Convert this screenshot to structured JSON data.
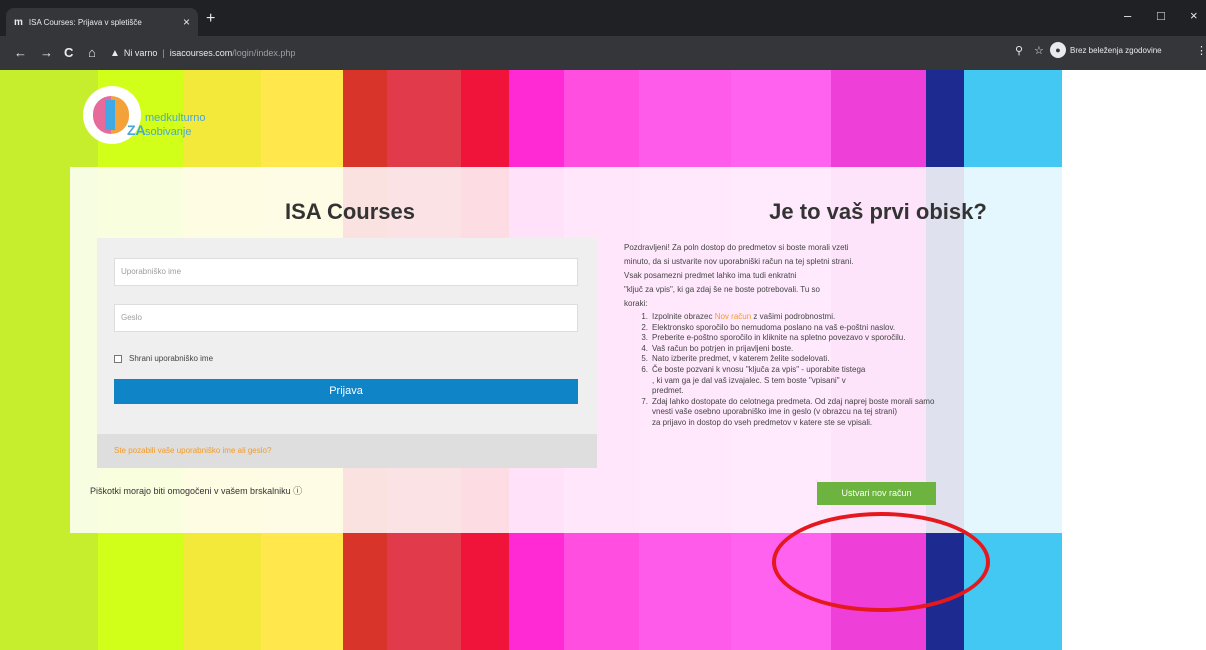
{
  "browser": {
    "tab_icon": "m",
    "tab_title": "ISA Courses: Prijava v spletišče",
    "tab_close": "×",
    "new_tab": "+",
    "window_minimize": "–",
    "window_restore": "□",
    "window_close": "×",
    "back": "←",
    "forward": "→",
    "reload": "C",
    "home": "⌂",
    "security_icon": "▲",
    "security_label": "Ni varno",
    "url_host": "isacourses.com",
    "url_path": "/login/index.php",
    "zoom_icon": "⚲",
    "star_icon": "☆",
    "incognito_label": "Brez beleženja zgodovine",
    "menu_icon": "⋮"
  },
  "logo": {
    "line1": "medkulturno",
    "line2": "sobivanje",
    "mark": "ZA"
  },
  "login": {
    "heading": "ISA Courses",
    "username_placeholder": "Uporabniško ime",
    "password_placeholder": "Geslo",
    "remember_label": "Shrani uporabniško ime",
    "submit_label": "Prijava",
    "forgot_link": "Ste pozabili vaše uporabniško ime ali geslo?",
    "cookies_notice": "Piškotki morajo biti omogočeni v vašem brskalniku",
    "cookies_help_icon": "ⓘ"
  },
  "signup": {
    "heading": "Je to vaš prvi obisk?",
    "intro_lines": [
      "Pozdravljeni! Za poln dostop do predmetov si boste morali vzeti",
      "minuto, da si ustvarite nov uporabniški račun na tej spletni strani.",
      "Vsak posamezni predmet lahko ima tudi enkratni",
      "\"ključ za vpis\", ki ga zdaj še ne boste potrebovali. Tu so",
      "koraki:"
    ],
    "steps": [
      {
        "num": "1.",
        "pre": "Izpolnite obrazec ",
        "link": "Nov račun",
        "post": " z vašimi podrobnostmi."
      },
      {
        "num": "2.",
        "text": "Elektronsko sporočilo bo nemudoma poslano na vaš e-poštni naslov."
      },
      {
        "num": "3.",
        "text": "Preberite e-poštno sporočilo in kliknite na spletno povezavo v sporočilu."
      },
      {
        "num": "4.",
        "text": "Vaš račun bo potrjen in prijavljeni boste."
      },
      {
        "num": "5.",
        "text": "Nato izberite predmet, v katerem želite sodelovati."
      },
      {
        "num": "6.",
        "text": "Če boste pozvani k vnosu \"ključa za vpis\" - uporabite tistega",
        "cont1": ", ki vam ga je dal vaš izvajalec. S tem boste \"vpisani\" v",
        "cont2": "predmet."
      },
      {
        "num": "7.",
        "text": "Zdaj lahko dostopate do celotnega predmeta. Od zdaj naprej boste morali samo",
        "cont1": "vnesti vaše osebno uporabniško ime in geslo (v obrazcu na tej strani)",
        "cont2": "za prijavo in dostop do vseh predmetov v katere ste se vpisali."
      }
    ],
    "create_button": "Ustvari nov račun"
  },
  "colors": {
    "login_button": "#0f84c6",
    "create_button": "#6cb33f",
    "link_orange": "#f59b23",
    "annotation_red": "#e5181d"
  },
  "background_stripes": [
    "#c6ee2c",
    "#d2ff1a",
    "#f3e93a",
    "#ffe74c",
    "#d8342a",
    "#e13a4a",
    "#f0143a",
    "#ff2ad4",
    "#ff4ee0",
    "#ff5bea",
    "#ff62ef",
    "#ef3fd9",
    "#1d2a8f",
    "#43c8f4"
  ]
}
